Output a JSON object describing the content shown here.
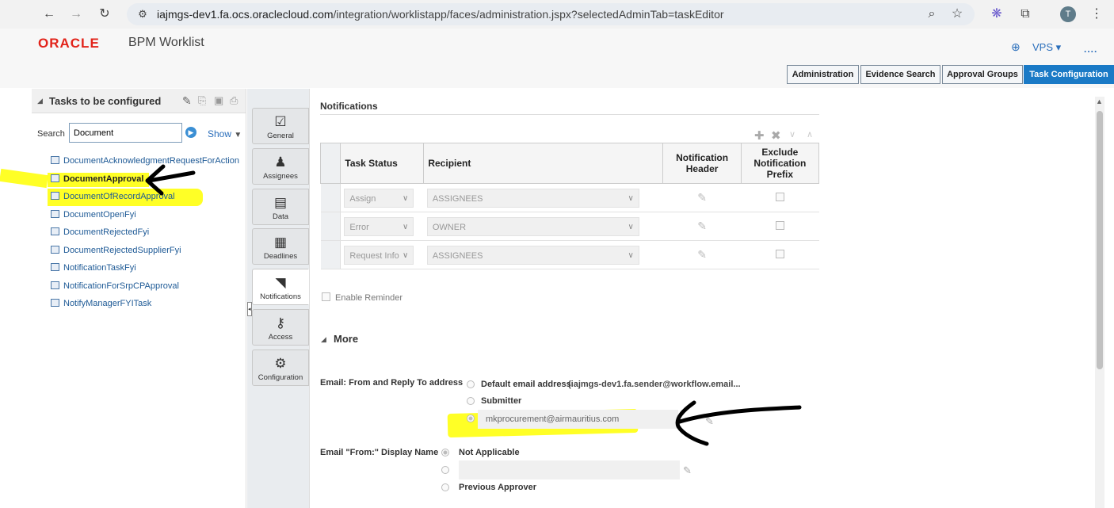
{
  "browser": {
    "url_host": "iajmgs-dev1.fa.ocs.oraclecloud.com",
    "url_path": "/integration/worklistapp/faces/administration.jspx?selectedAdminTab=taskEditor",
    "avatar_letter": "T",
    "icons": [
      "back-arrow-icon",
      "forward-arrow-icon",
      "reload-icon",
      "site-settings-icon",
      "zoom-icon",
      "star-icon",
      "extension-icon",
      "puzzle-icon",
      "menu-dots-icon"
    ]
  },
  "header": {
    "logo": "ORACLE",
    "app_title": "BPM Worklist",
    "user": "VPS ▾",
    "more": "...."
  },
  "top_tabs": [
    {
      "label": "Administration"
    },
    {
      "label": "Evidence Search"
    },
    {
      "label": "Approval Groups"
    },
    {
      "label": "Task Configuration",
      "active": true
    }
  ],
  "left_panel": {
    "title": "Tasks to be configured",
    "search_label": "Search",
    "search_value": "Document",
    "show_label": "Show",
    "tasks": [
      "DocumentAcknowledgmentRequestForAction",
      "DocumentApproval",
      "DocumentOfRecordApproval",
      "DocumentOpenFyi",
      "DocumentRejectedFyi",
      "DocumentRejectedSupplierFyi",
      "NotificationTaskFyi",
      "NotificationForSrpCPApproval",
      "NotifyManagerFYITask"
    ],
    "selected_index": 1
  },
  "vertical_tabs": [
    {
      "label": "General",
      "icon": "clipboard-check-icon"
    },
    {
      "label": "Assignees",
      "icon": "person-icon"
    },
    {
      "label": "Data",
      "icon": "briefcase-icon"
    },
    {
      "label": "Deadlines",
      "icon": "calendar-icon"
    },
    {
      "label": "Notifications",
      "icon": "rss-icon",
      "active": true
    },
    {
      "label": "Access",
      "icon": "keys-icon"
    },
    {
      "label": "Configuration",
      "icon": "gear-icon"
    }
  ],
  "notifications": {
    "title": "Notifications",
    "columns": [
      "Task Status",
      "Recipient",
      "Notification Header",
      "Exclude Notification Prefix"
    ],
    "rows": [
      {
        "status": "Assign",
        "recipient": "ASSIGNEES"
      },
      {
        "status": "Error",
        "recipient": "OWNER"
      },
      {
        "status": "Request Info",
        "recipient": "ASSIGNEES"
      }
    ],
    "enable_reminder": "Enable Reminder"
  },
  "more": {
    "title": "More",
    "email_label": "Email: From and Reply To address",
    "email_options": [
      "Default email address",
      "Submitter"
    ],
    "default_email": "(iajmgs-dev1.fa.sender@workflow.email...",
    "custom_email": "mkprocurement@airmauritius.com",
    "display_name_label": "Email \"From:\" Display Name",
    "display_options": [
      "Not Applicable",
      "Previous Approver"
    ]
  },
  "colors": {
    "accent": "#1a7ac6",
    "oracle_red": "#e2231a",
    "highlight": "#ffff00"
  }
}
